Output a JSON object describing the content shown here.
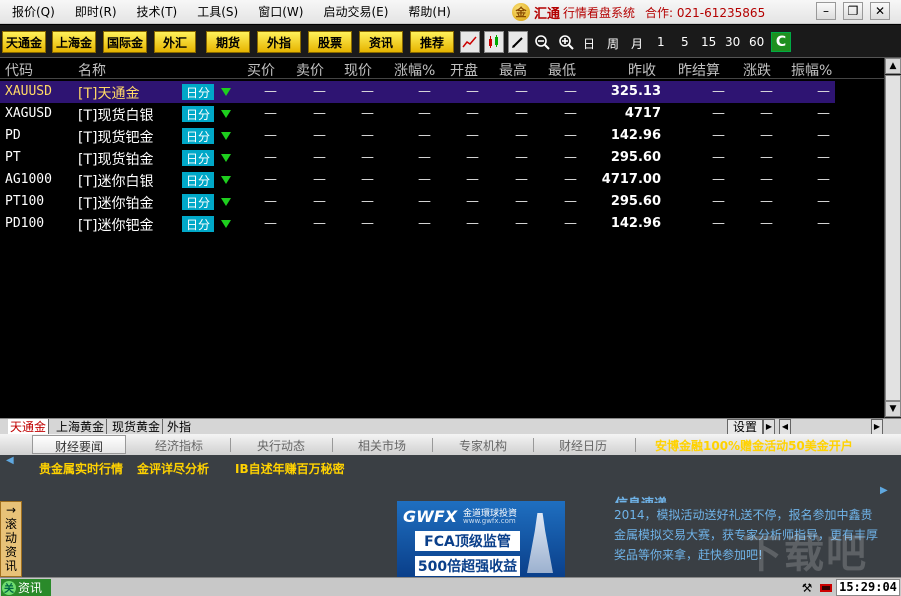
{
  "menu": [
    "报价(Q)",
    "即时(R)",
    "技术(T)",
    "工具(S)",
    "窗口(W)",
    "启动交易(E)",
    "帮助(H)"
  ],
  "brand": {
    "logo": "金",
    "name": "汇通",
    "subtitle": "行情看盘系统",
    "contact": "合作: 021-61235865"
  },
  "window_controls": {
    "minimize": "–",
    "restore": "❐",
    "close": "✕"
  },
  "toolbar": {
    "buttons": [
      "天通金",
      "上海金",
      "国际金",
      "外汇",
      "期货",
      "外指",
      "股票",
      "资讯",
      "推荐"
    ],
    "icons": [
      "line-chart-icon",
      "candle-chart-icon",
      "pen-icon",
      "zoom-out-icon",
      "zoom-in-icon"
    ],
    "periods": [
      "日",
      "周",
      "月",
      "1",
      "5",
      "15",
      "30",
      "60"
    ],
    "refresh": "C"
  },
  "colors": {
    "accent": "#e6b400",
    "selected_row": "#2e1472",
    "badge": "#00a8c8",
    "down": "#1ecf1e",
    "brand": "#b40000"
  },
  "table": {
    "columns": [
      "代码",
      "名称",
      "买价",
      "卖价",
      "现价",
      "涨幅%",
      "开盘",
      "最高",
      "最低",
      "昨收",
      "昨结算",
      "涨跌",
      "振幅%"
    ],
    "badge_label": "日分",
    "rows": [
      {
        "code": "XAUUSD",
        "name": "[T]天通金",
        "prev_close": "325.13",
        "selected": true
      },
      {
        "code": "XAGUSD",
        "name": "[T]现货白银",
        "prev_close": "4717",
        "selected": false
      },
      {
        "code": "PD",
        "name": "[T]现货钯金",
        "prev_close": "142.96",
        "selected": false
      },
      {
        "code": "PT",
        "name": "[T]现货铂金",
        "prev_close": "295.60",
        "selected": false
      },
      {
        "code": "AG1000",
        "name": "[T]迷你白银",
        "prev_close": "4717.00",
        "selected": false
      },
      {
        "code": "PT100",
        "name": "[T]迷你铂金",
        "prev_close": "295.60",
        "selected": false
      },
      {
        "code": "PD100",
        "name": "[T]迷你钯金",
        "prev_close": "142.96",
        "selected": false
      }
    ],
    "empty_value": "—"
  },
  "bottom_tabs": [
    "天通金",
    "上海黄金",
    "现货黄金",
    "外指"
  ],
  "settings_label": "设置",
  "news": {
    "tabs": [
      "财经要闻",
      "经济指标",
      "央行动态",
      "相关市场",
      "专家机构",
      "财经日历"
    ],
    "promo": "安博金融100%赠金活动50美金开户",
    "links": [
      "贵金属实时行情",
      "金评详尽分析",
      "IB自述年赚百万秘密"
    ],
    "scroll_label": [
      "→",
      "滚",
      "动",
      "资",
      "讯"
    ],
    "info_title": "信息速递",
    "info_text": "2014，模拟活动送好礼送不停，报名参加中鑫贵金属模拟交易大赛，获专家分析师指导，更有丰厚奖品等你来拿，赶快参加吧!",
    "watermark": "下载吧",
    "ad": {
      "logo": "GWFX",
      "sub": "金道環球投資",
      "url": "www.gwfx.com",
      "line1": "FCA顶级监管",
      "line2": "500倍超强收益"
    }
  },
  "status": {
    "news_label": "资讯",
    "news_icon": "关",
    "time": "15:29:04"
  }
}
